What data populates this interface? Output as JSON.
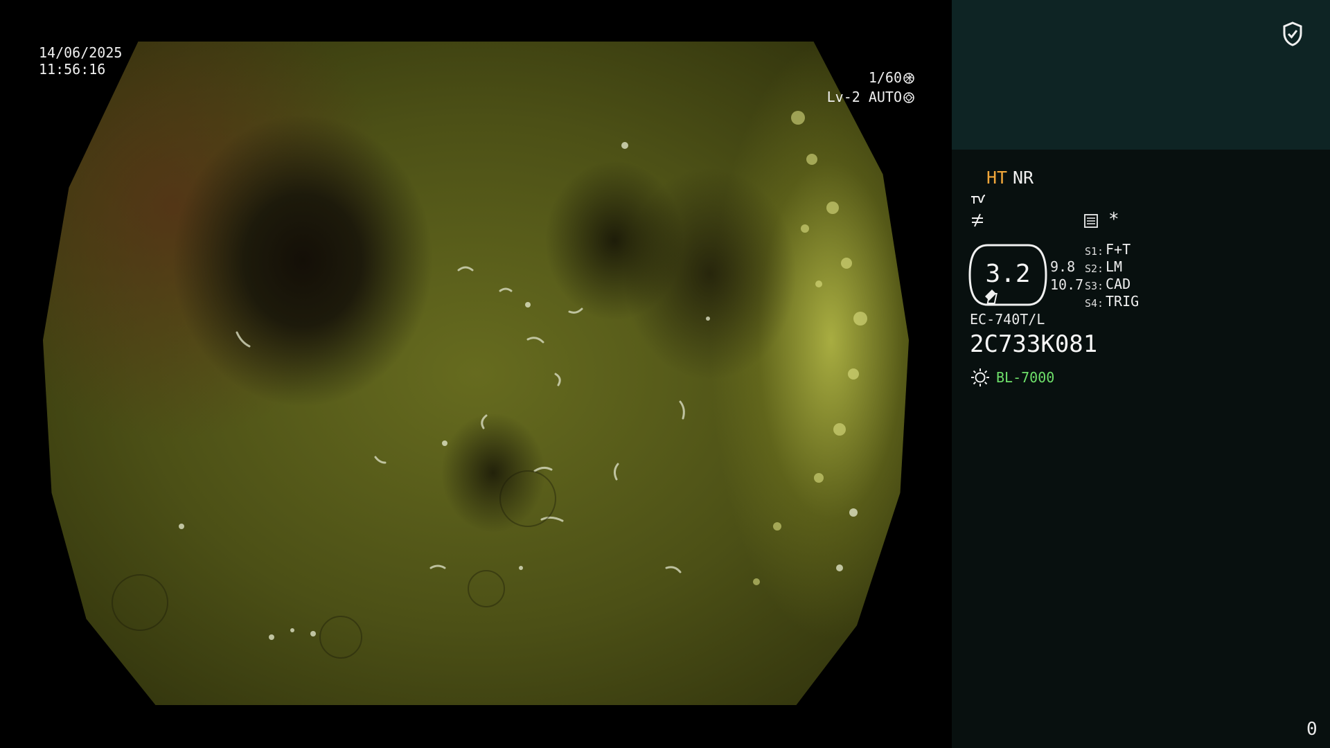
{
  "overlay": {
    "date": "14/06/2025",
    "time": "11:56:16",
    "shutter": "1/60",
    "level": "Lv-2 AUTO"
  },
  "icons": {
    "shutter": "aperture-icon",
    "level": "iris-icon",
    "status": "shield-check-icon",
    "wave": "wave-enhance-icon",
    "not_equal": "not-equal-icon",
    "list": "list-menu-icon",
    "light": "sun-icon"
  },
  "panel": {
    "mode_ht": "HT",
    "mode_nr": "NR",
    "star": "*",
    "zoom": "3.2",
    "readout_1": "9.8",
    "readout_2": "10.7",
    "slots": [
      {
        "key": "S1:",
        "value": "F+T"
      },
      {
        "key": "S2:",
        "value": "LM"
      },
      {
        "key": "S3:",
        "value": "CAD"
      },
      {
        "key": "S4:",
        "value": "TRIG"
      }
    ],
    "scope_model": "EC-740T/L",
    "serial": "2C733K081",
    "light_source": "BL-7000",
    "counter": "0"
  },
  "colors": {
    "ht_accent": "#f0a63a",
    "light_source": "#6ee06a",
    "panel_top": "#0e2424",
    "panel_bg": "#08100f"
  }
}
